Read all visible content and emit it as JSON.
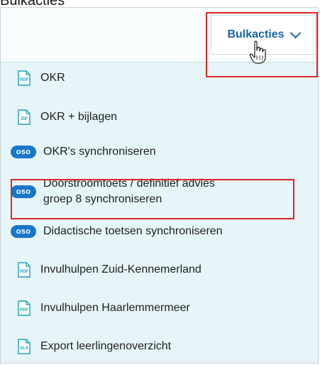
{
  "caption": "Bulkacties",
  "toolbar": {
    "button_label": "Bulkacties"
  },
  "menu": {
    "items": [
      {
        "label": "OKR",
        "icon": "PDF"
      },
      {
        "label": "OKR + bijlagen",
        "icon": "ZIP"
      },
      {
        "label": "OKR's synchroniseren",
        "icon": "oso"
      },
      {
        "label": "Doorstroomtoets / definitief advies",
        "label2": "groep 8 synchroniseren",
        "icon": "oso"
      },
      {
        "label": "Didactische toetsen synchroniseren",
        "icon": "oso"
      },
      {
        "label": "Invulhulpen Zuid-Kennemerland",
        "icon": "PDF"
      },
      {
        "label": "Invulhulpen Haarlemmermeer",
        "icon": "PDF"
      },
      {
        "label": "Export leerlingenoverzicht",
        "icon": "XLS"
      }
    ]
  },
  "colors": {
    "accent": "#1565a8",
    "panel_bg": "#e6f5f8",
    "oso_badge": "#1976c8",
    "highlight": "#e02525",
    "doc_icon": "#1aa0b8"
  }
}
